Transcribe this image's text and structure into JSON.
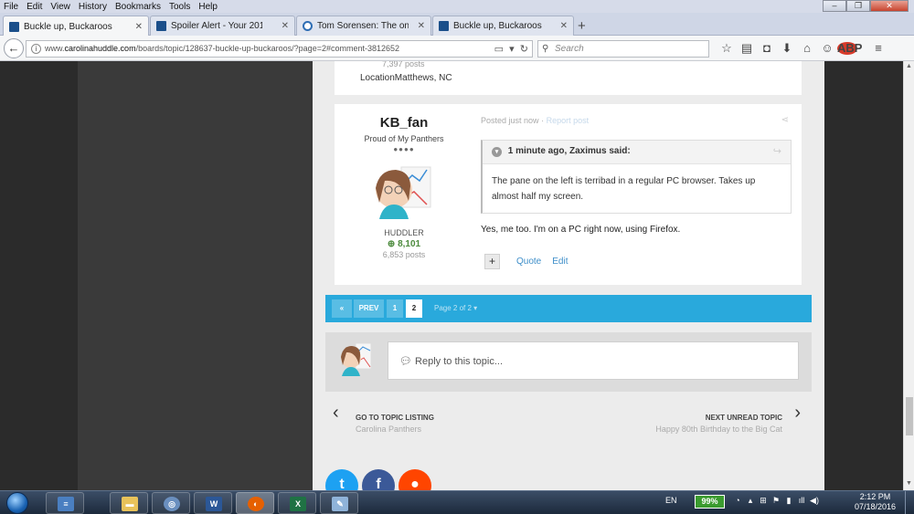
{
  "menu": [
    "File",
    "Edit",
    "View",
    "History",
    "Bookmarks",
    "Tools",
    "Help"
  ],
  "tabs": [
    {
      "label": "Buckle up, Buckaroos - Pa...",
      "active": true
    },
    {
      "label": "Spoiler Alert - Your 2016 N...",
      "active": false
    },
    {
      "label": "Tom Sorensen: The one thi...",
      "active": false
    },
    {
      "label": "Buckle up, Buckaroos - Pa...",
      "active": false
    }
  ],
  "nav": {
    "url_prefix": "www.",
    "url_domain": "carolinahuddle.com",
    "url_path": "/boards/topic/128637-buckle-up-buckaroos/?page=2#comment-3812652",
    "search_placeholder": "Search"
  },
  "prev_post": {
    "posts": "7,397 posts",
    "location": "LocationMatthews, NC"
  },
  "post": {
    "username": "KB_fan",
    "user_title": "Proud of My Panthers",
    "pips": "●●●●",
    "rank": "HUDDLER",
    "reputation": "8,101",
    "post_count": "6,853 posts",
    "posted": "Posted just now",
    "separator": "·",
    "report": "Report post",
    "quote_header": "1 minute ago, Zaximus said:",
    "quote_text": "The pane on the left is terribad in a regular PC browser.   Takes up almost half my screen.",
    "body": "Yes, me too.  I'm on a PC right now, using Firefox.",
    "quote_label": "Quote",
    "edit_label": "Edit"
  },
  "pagination": {
    "first": "«",
    "prev": "PREV",
    "pages": [
      "1",
      "2"
    ],
    "current": "2",
    "total": "Page 2 of 2 ▾"
  },
  "reply": {
    "placeholder": "Reply to this topic..."
  },
  "topic_nav": {
    "left_label": "GO TO TOPIC LISTING",
    "left_sub": "Carolina Panthers",
    "right_label": "NEXT UNREAD TOPIC",
    "right_sub": "Happy 80th Birthday to the Big Cat"
  },
  "taskbar": {
    "lang": "EN",
    "battery": "99%",
    "time": "2:12 PM",
    "date": "07/18/2016"
  },
  "colors": {
    "accent": "#29a9dc",
    "link": "#3d8ec9",
    "rep": "#4b8a3c"
  }
}
